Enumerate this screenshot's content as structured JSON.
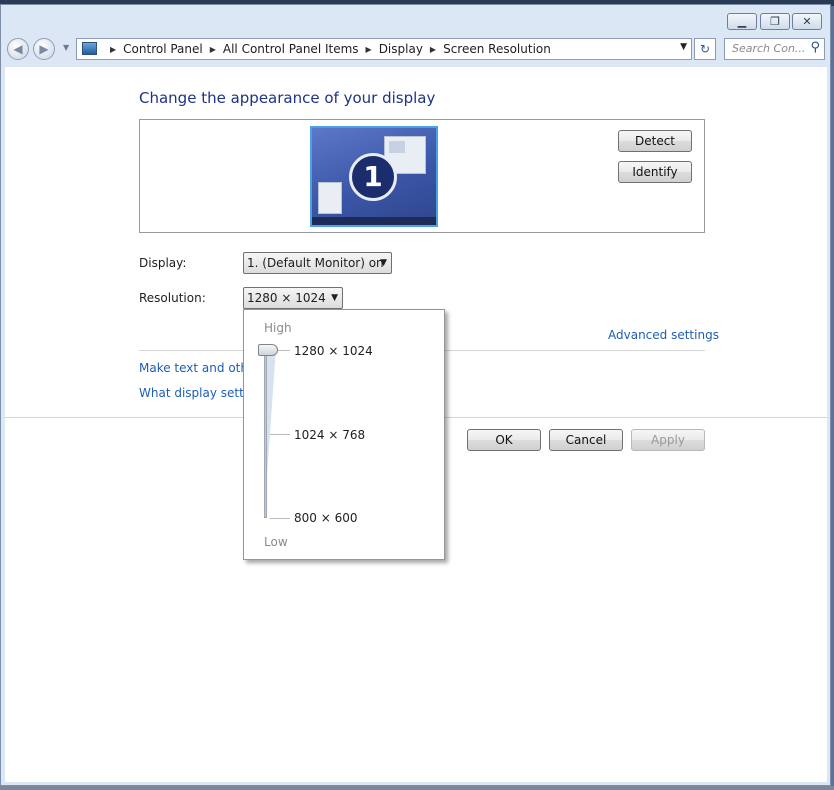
{
  "breadcrumbs": [
    "Control Panel",
    "All Control Panel Items",
    "Display",
    "Screen Resolution"
  ],
  "search_placeholder": "Search Con...",
  "page_title": "Change the appearance of your display",
  "monitor_number": "1",
  "buttons": {
    "detect": "Detect",
    "identify": "Identify",
    "ok": "OK",
    "cancel": "Cancel",
    "apply": "Apply"
  },
  "display": {
    "label": "Display:",
    "value": "1. (Default Monitor) on"
  },
  "resolution": {
    "label": "Resolution:",
    "value": "1280 × 1024",
    "slider_high": "High",
    "slider_low": "Low",
    "options": [
      "1280 × 1024",
      "1024 × 768",
      "800 × 600"
    ],
    "selected_index": 0
  },
  "advanced_link": "Advanced settings",
  "links": {
    "text_size": "Make text and other",
    "help": "What display setting"
  },
  "colors": {
    "link": "#1e5db7",
    "title": "#1e3287",
    "monitor_border": "#4aa3e0"
  }
}
